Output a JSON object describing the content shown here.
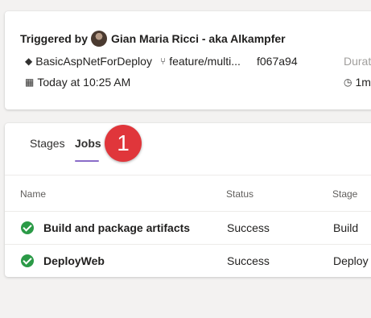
{
  "summary": {
    "triggered_prefix": "Triggered by",
    "user_name": "Gian Maria Ricci - aka Alkampfer",
    "repo": "BasicAspNetForDeploy",
    "branch": "feature/multi...",
    "commit": "f067a94",
    "duration_label": "Durat",
    "time": "Today at 10:25 AM",
    "duration_value": "1m"
  },
  "tabs": [
    {
      "label": "Stages",
      "selected": false
    },
    {
      "label": "Jobs",
      "selected": true
    }
  ],
  "callout_number": "1",
  "table": {
    "columns": [
      "Name",
      "Status",
      "Stage"
    ],
    "rows": [
      {
        "name": "Build and package artifacts",
        "status": "Success",
        "stage": "Build"
      },
      {
        "name": "DeployWeb",
        "status": "Success",
        "stage": "Deploy"
      }
    ]
  },
  "colors": {
    "success": "#2b9a47",
    "tab_accent": "#8a6cc8",
    "callout": "#e0363b"
  }
}
